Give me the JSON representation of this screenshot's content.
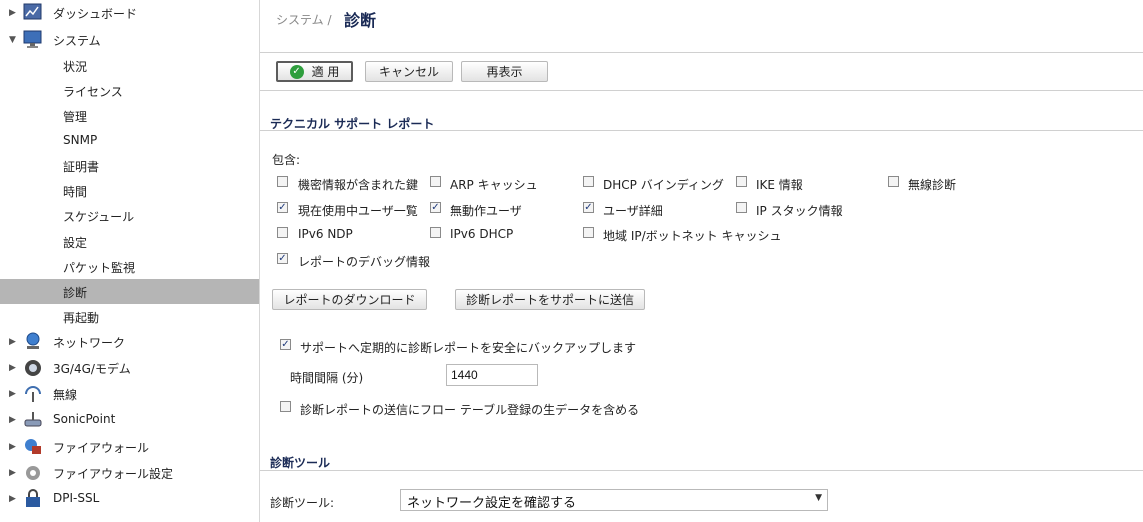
{
  "sidebar": {
    "top_items_a": [
      {
        "label": "ダッシュボード",
        "arrow": "▶",
        "icon": "dashboard-icon"
      },
      {
        "label": "システム",
        "arrow": "▼",
        "icon": "system-monitor-icon"
      }
    ],
    "sub_items": [
      {
        "label": "状況"
      },
      {
        "label": "ライセンス"
      },
      {
        "label": "管理"
      },
      {
        "label": "SNMP"
      },
      {
        "label": "証明書"
      },
      {
        "label": "時間"
      },
      {
        "label": "スケジュール"
      },
      {
        "label": "設定"
      },
      {
        "label": "パケット監視"
      },
      {
        "label": "診断",
        "active": true
      },
      {
        "label": "再起動"
      }
    ],
    "top_items_b": [
      {
        "label": "ネットワーク",
        "arrow": "▶",
        "icon": "network-icon"
      },
      {
        "label": "3G/4G/モデム",
        "arrow": "▶",
        "icon": "modem-icon"
      },
      {
        "label": "無線",
        "arrow": "▶",
        "icon": "wireless-icon"
      },
      {
        "label": "SonicPoint",
        "arrow": "▶",
        "icon": "access-point-icon"
      },
      {
        "label": "ファイアウォール",
        "arrow": "▶",
        "icon": "firewall-icon"
      },
      {
        "label": "ファイアウォール設定",
        "arrow": "▶",
        "icon": "firewall-settings-icon"
      },
      {
        "label": "DPI-SSL",
        "arrow": "▶",
        "icon": "dpi-ssl-icon"
      }
    ]
  },
  "header": {
    "breadcrumb": "システム /",
    "title": "診断"
  },
  "toolbar": {
    "apply_label": "適 用",
    "cancel_label": "キャンセル",
    "refresh_label": "再表示"
  },
  "tsr": {
    "section_title": "テクニカル サポート レポート",
    "include_label": "包含:",
    "options": [
      {
        "label": "機密情報が含まれた鍵",
        "checked": false
      },
      {
        "label": "ARP キャッシュ",
        "checked": false
      },
      {
        "label": "DHCP バインディング",
        "checked": false
      },
      {
        "label": "IKE 情報",
        "checked": false
      },
      {
        "label": "無線診断",
        "checked": false
      },
      {
        "label": "現在使用中ユーザ一覧",
        "checked": true
      },
      {
        "label": "無動作ユーザ",
        "checked": true
      },
      {
        "label": "ユーザ詳細",
        "checked": true
      },
      {
        "label": "IP スタック情報",
        "checked": false
      },
      {
        "label": "IPv6 NDP",
        "checked": false
      },
      {
        "label": "IPv6 DHCP",
        "checked": false
      },
      {
        "label": "地域 IP/ボットネット キャッシュ",
        "checked": false
      },
      {
        "label": "レポートのデバッグ情報",
        "checked": true
      }
    ],
    "download_label": "レポートのダウンロード",
    "send_label": "診断レポートをサポートに送信",
    "backup_label": "サポートへ定期的に診断レポートを安全にバックアップします",
    "backup_checked": true,
    "interval_label": "時間間隔 (分)",
    "interval_value": "1440",
    "include_flow_label": "診断レポートの送信にフロー テーブル登録の生データを含める",
    "include_flow_checked": false
  },
  "tools": {
    "section_title": "診断ツール",
    "tool_label": "診断ツール:",
    "tool_selected": "ネットワーク設定を確認する"
  }
}
